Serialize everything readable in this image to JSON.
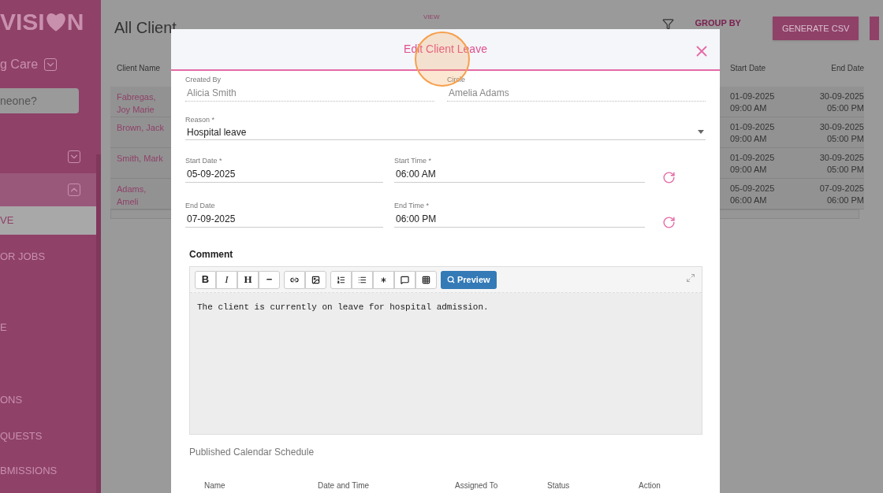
{
  "sidebar": {
    "logo_left": "VISI",
    "logo_right": "N",
    "org": "g Care",
    "search": {
      "placeholder": "neone?"
    },
    "sections": [
      {
        "expanded": false,
        "selected": false
      },
      {
        "expanded": true,
        "selected": true
      }
    ],
    "items": [
      {
        "label": "VE",
        "selected": true
      },
      {
        "label": "OR JOBS",
        "selected": false
      },
      {
        "label": "E",
        "selected": false
      },
      {
        "label": "ONS",
        "selected": false
      },
      {
        "label": "QUESTS",
        "selected": false
      },
      {
        "label": "BMISSIONS",
        "selected": false
      }
    ]
  },
  "page": {
    "title": "All Client",
    "view_label": "VIEW",
    "group_by": "GROUP BY",
    "generate_csv": "GENERATE CSV"
  },
  "table": {
    "columns": [
      "Client Name",
      "Start Date",
      "End Date"
    ],
    "rows": [
      {
        "name": "Fabregas, Joy Marie",
        "start_date": "01-09-2025",
        "start_time": "09:00 AM",
        "end_date": "30-09-2025",
        "end_time": "05:00 PM"
      },
      {
        "name": "Brown, Jack",
        "start_date": "01-09-2025",
        "start_time": "09:00 AM",
        "end_date": "30-09-2025",
        "end_time": "05:00 PM"
      },
      {
        "name": "Smith, Mark",
        "start_date": "01-09-2025",
        "start_time": "09:00 AM",
        "end_date": "30-09-2025",
        "end_time": "05:00 PM"
      },
      {
        "name": "Adams, Ameli",
        "start_date": "05-09-2025",
        "start_time": "06:00 AM",
        "end_date": "07-09-2025",
        "end_time": "06:00 PM"
      }
    ]
  },
  "modal": {
    "title": "Edit Client Leave",
    "created_by": {
      "label": "Created By",
      "value": "Alicia Smith"
    },
    "circle": {
      "label": "Circle",
      "value": "Amelia Adams"
    },
    "reason": {
      "label": "Reason *",
      "value": "Hospital leave"
    },
    "start_date": {
      "label": "Start Date *",
      "value": "05-09-2025"
    },
    "start_time": {
      "label": "Start Time *",
      "value": "06:00 AM"
    },
    "end_date": {
      "label": "End Date",
      "value": "07-09-2025"
    },
    "end_time": {
      "label": "End Time *",
      "value": "06:00 PM"
    },
    "comment_label": "Comment",
    "toolbar_groups": [
      [
        {
          "kind": "text",
          "label": "B"
        },
        {
          "kind": "text",
          "label": "I"
        },
        {
          "kind": "text",
          "label": "H"
        },
        {
          "kind": "text",
          "label": "−"
        }
      ],
      [
        {
          "kind": "icon"
        },
        {
          "kind": "icon"
        }
      ],
      [
        {
          "kind": "icon"
        },
        {
          "kind": "icon"
        },
        {
          "kind": "icon"
        },
        {
          "kind": "icon"
        },
        {
          "kind": "icon"
        }
      ]
    ],
    "preview": "Preview",
    "comment": "The client is currently on leave for hospital admission.",
    "schedule_title": "Published Calendar Schedule",
    "schedule_columns": [
      "Name",
      "Date and Time",
      "Assigned To",
      "Status",
      "Action"
    ]
  }
}
